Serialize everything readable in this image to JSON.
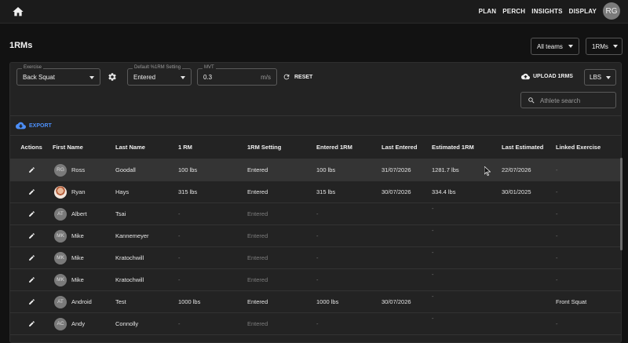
{
  "nav": {
    "items": [
      "PLAN",
      "PERCH",
      "INSIGHTS",
      "DISPLAY"
    ],
    "avatar_initials": "RG"
  },
  "page": {
    "title": "1RMs",
    "teams_select": "All teams",
    "view_select": "1RMs"
  },
  "filters": {
    "exercise": {
      "label": "Exercise",
      "value": "Back Squat"
    },
    "setting": {
      "label": "Default %1RM Setting",
      "value": "Entered"
    },
    "mvt": {
      "label": "MVT",
      "value": "0.3",
      "unit": "m/s"
    },
    "reset_label": "RESET",
    "upload_label": "UPLOAD 1RMS",
    "units": "LBS",
    "search_placeholder": "Athlete search",
    "export_label": "EXPORT"
  },
  "table": {
    "columns": [
      "Actions",
      "First Name",
      "Last Name",
      "1 RM",
      "1RM Setting",
      "Entered 1RM",
      "Last Entered",
      "Estimated 1RM",
      "Last Estimated",
      "Linked Exercise"
    ],
    "rows": [
      {
        "initials": "RG",
        "photo": false,
        "first": "Ross",
        "last": "Goodall",
        "rm": "100 lbs",
        "setting": "Entered",
        "entered": "100 lbs",
        "last_entered": "31/07/2026",
        "estimated": "1281.7 lbs",
        "last_estimated": "22/07/2026",
        "linked": "-"
      },
      {
        "initials": "",
        "photo": true,
        "first": "Ryan",
        "last": "Hays",
        "rm": "315 lbs",
        "setting": "Entered",
        "entered": "315 lbs",
        "last_entered": "30/07/2026",
        "estimated": "334.4 lbs",
        "last_estimated": "30/01/2025",
        "linked": "-"
      },
      {
        "initials": "AT",
        "photo": false,
        "first": "Albert",
        "last": "Tsai",
        "rm": "-",
        "setting": "Entered",
        "entered": "-",
        "last_entered": "",
        "estimated": "-",
        "last_estimated": "",
        "linked": "-"
      },
      {
        "initials": "MK",
        "photo": false,
        "first": "Mike",
        "last": "Kannemeyer",
        "rm": "-",
        "setting": "Entered",
        "entered": "-",
        "last_entered": "",
        "estimated": "-",
        "last_estimated": "",
        "linked": "-"
      },
      {
        "initials": "MK",
        "photo": false,
        "first": "Mike",
        "last": "Kratochwill",
        "rm": "-",
        "setting": "Entered",
        "entered": "-",
        "last_entered": "",
        "estimated": "-",
        "last_estimated": "",
        "linked": "-"
      },
      {
        "initials": "MK",
        "photo": false,
        "first": "Mike",
        "last": "Kratochwill",
        "rm": "-",
        "setting": "Entered",
        "entered": "-",
        "last_entered": "",
        "estimated": "-",
        "last_estimated": "",
        "linked": "-"
      },
      {
        "initials": "AT",
        "photo": false,
        "first": "Android",
        "last": "Test",
        "rm": "1000 lbs",
        "setting": "Entered",
        "entered": "1000 lbs",
        "last_entered": "30/07/2026",
        "estimated": "-",
        "last_estimated": "",
        "linked": "Front Squat"
      },
      {
        "initials": "AC",
        "photo": false,
        "first": "Andy",
        "last": "Connolly",
        "rm": "-",
        "setting": "Entered",
        "entered": "-",
        "last_entered": "",
        "estimated": "-",
        "last_estimated": "",
        "linked": "-"
      }
    ]
  }
}
